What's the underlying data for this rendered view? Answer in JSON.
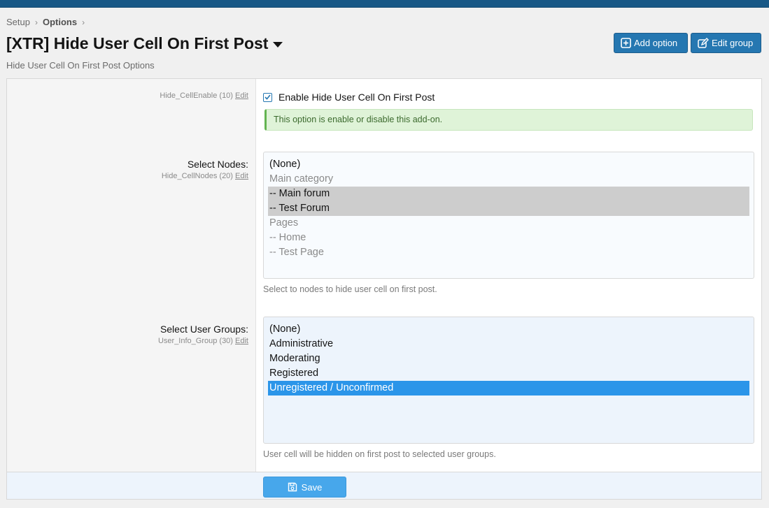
{
  "breadcrumb": {
    "items": [
      "Setup",
      "Options"
    ]
  },
  "header": {
    "title": "[XTR] Hide User Cell On First Post",
    "description": "Hide User Cell On First Post Options",
    "add_option_label": "Add option",
    "edit_group_label": "Edit group"
  },
  "options": {
    "enable": {
      "hint_id": "Hide_CellEnable (10)",
      "edit_label": "Edit",
      "checkbox_label": "Enable Hide User Cell On First Post",
      "checked": true,
      "explain": "This option is enable or disable this add-on."
    },
    "nodes": {
      "label": "Select Nodes:",
      "hint_id": "Hide_CellNodes (20)",
      "edit_label": "Edit",
      "items": [
        "(None)",
        "Main category",
        "-- Main forum",
        "-- Test Forum",
        "Pages",
        "-- Home",
        "-- Test Page"
      ],
      "explain": "Select to nodes to hide user cell on first post."
    },
    "groups": {
      "label": "Select User Groups:",
      "hint_id": "User_Info_Group (30)",
      "edit_label": "Edit",
      "items": [
        "(None)",
        "Administrative",
        "Moderating",
        "Registered",
        "Unregistered / Unconfirmed"
      ],
      "explain": "User cell will be hidden on first post to selected user groups."
    }
  },
  "footer": {
    "save_label": "Save"
  },
  "colors": {
    "topbar": "#185886",
    "primary_button": "#2577b1",
    "save_button": "#47a7eb",
    "selected_option": "#2b95e9",
    "notice_bg": "#dff3d8"
  }
}
